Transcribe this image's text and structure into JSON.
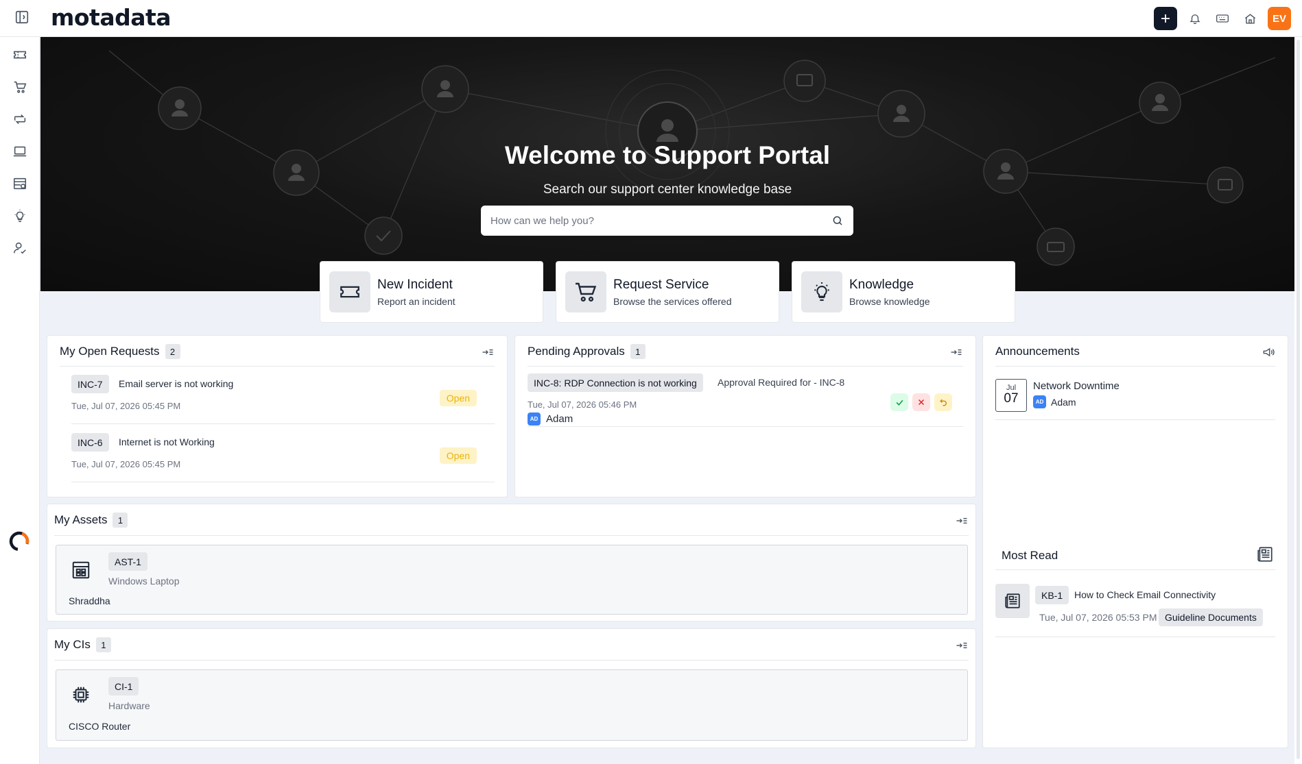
{
  "brand": {
    "logo_text": "motadata",
    "user_initials": "EV"
  },
  "hero": {
    "title": "Welcome to Support Portal",
    "subtitle": "Search our support center knowledge base",
    "search_placeholder": "How can we help you?"
  },
  "quick_actions": [
    {
      "title": "New Incident",
      "subtitle": "Report an incident",
      "icon": "ticket-icon"
    },
    {
      "title": "Request Service",
      "subtitle": "Browse the services offered",
      "icon": "cart-icon"
    },
    {
      "title": "Knowledge",
      "subtitle": "Browse knowledge",
      "icon": "lightbulb-icon"
    }
  ],
  "open_requests": {
    "title": "My Open Requests",
    "count": "2",
    "items": [
      {
        "id": "INC-7",
        "title": "Email server is not working",
        "date": "Tue, Jul 07, 2026 05:45 PM",
        "status": "Open"
      },
      {
        "id": "INC-6",
        "title": "Internet is not Working",
        "date": "Tue, Jul 07, 2026 05:45 PM",
        "status": "Open"
      }
    ]
  },
  "pending_approvals": {
    "title": "Pending Approvals",
    "count": "1",
    "items": [
      {
        "ref": "INC-8: RDP Connection is not working",
        "desc": "Approval Required for - INC-8",
        "date": "Tue, Jul 07, 2026 05:46 PM",
        "user_initials": "AD",
        "user": "Adam"
      }
    ]
  },
  "announcements": {
    "title": "Announcements",
    "items": [
      {
        "month": "Jul",
        "day": "07",
        "title": "Network Downtime",
        "user_initials": "AD",
        "user": "Adam"
      }
    ]
  },
  "assets": {
    "title": "My Assets",
    "count": "1",
    "items": [
      {
        "id": "AST-1",
        "type": "Windows Laptop",
        "owner": "Shraddha"
      }
    ]
  },
  "cis": {
    "title": "My CIs",
    "count": "1",
    "items": [
      {
        "id": "CI-1",
        "type": "Hardware",
        "name": "CISCO Router"
      }
    ]
  },
  "most_read": {
    "title": "Most Read",
    "items": [
      {
        "id": "KB-1",
        "title": "How to Check Email Connectivity",
        "date": "Tue, Jul 07, 2026 05:53 PM",
        "category": "Guideline Documents"
      }
    ]
  },
  "colors": {
    "accent": "#f97316",
    "dark": "#111827",
    "open_badge": "#fef3c7",
    "approve": "#dcfce7",
    "reject": "#fee2e2",
    "refer": "#fef3c7"
  }
}
